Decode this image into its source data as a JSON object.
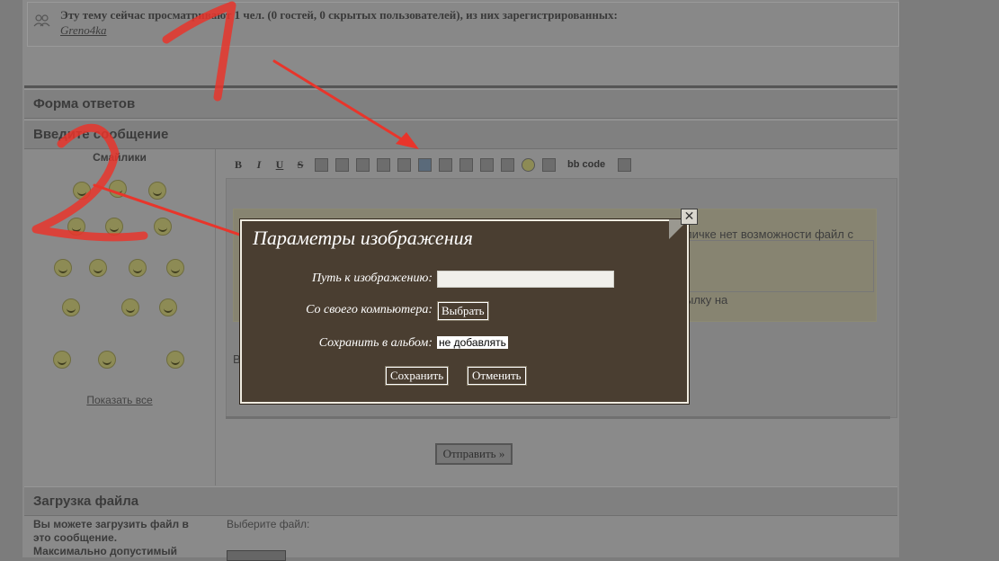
{
  "online": {
    "text": "Эту тему сейчас просматривают 1 чел. (0 гостей, 0 скрытых пользователей), из них зарегистрированных:",
    "user": "Greno4ka"
  },
  "sections": {
    "reply_form": "Форма ответов",
    "enter_message": "Введите сообщение",
    "upload": "Загрузка файла"
  },
  "smiles": {
    "title": "Смайлики",
    "show_all": "Показать все"
  },
  "toolbar": {
    "bold": "B",
    "italic": "I",
    "underline": "U",
    "strike": "S",
    "bbcode": "bb code"
  },
  "editor": {
    "bg_text_1": "личке нет возможности файл с",
    "bg_text_2": "ылку на",
    "letter": "В",
    "send": "Отправить »"
  },
  "upload": {
    "desc_1": "Вы можете загрузить файл в",
    "desc_2": "это сообщение.",
    "desc_3": "Максимально допустимый",
    "choose_file": "Выберите файл:"
  },
  "dialog": {
    "title": "Параметры изображения",
    "path_label": "Путь к изображению:",
    "path_value": "",
    "computer_label": "Со своего компьютера:",
    "choose_button": "Выбрать",
    "album_label": "Сохранить в альбом:",
    "album_value": "не добавлять",
    "save_button": "Сохранить",
    "cancel_button": "Отменить",
    "close": "✕"
  },
  "colors": {
    "dialog_bg": "#4a3e31",
    "arrow": "#e8352b",
    "dimmed_page": "#8a8a8a"
  }
}
